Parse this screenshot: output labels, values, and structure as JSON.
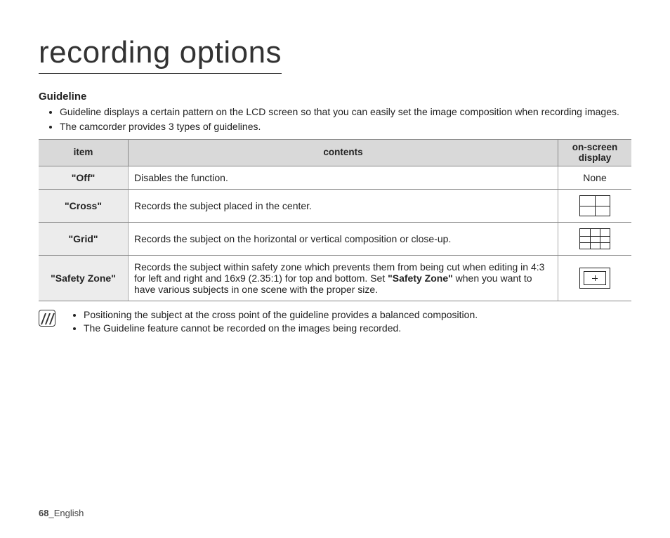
{
  "title": "recording options",
  "section": "Guideline",
  "intro": [
    "Guideline displays a certain pattern on the LCD screen so that you can easily set the image composition when recording images.",
    "The camcorder provides 3 types of guidelines."
  ],
  "table": {
    "headers": {
      "item": "item",
      "contents": "contents",
      "osd": "on-screen display"
    },
    "rows": [
      {
        "item": "\"Off\"",
        "contents": "Disables the function.",
        "osd_text": "None",
        "osd_icon": "none"
      },
      {
        "item": "\"Cross\"",
        "contents": "Records the subject placed in the center.",
        "osd_text": "",
        "osd_icon": "cross"
      },
      {
        "item": "\"Grid\"",
        "contents": "Records the subject on the horizontal or vertical composition or close-up.",
        "osd_text": "",
        "osd_icon": "grid"
      },
      {
        "item": "\"Safety Zone\"",
        "contents_prefix": "Records the subject within safety zone which prevents them from being cut when editing in 4:3 for left and right and 16x9 (2.35:1) for top and bottom. Set ",
        "contents_bold": "\"Safety Zone\"",
        "contents_suffix": " when you want to have various subjects in one scene with the proper size.",
        "osd_text": "",
        "osd_icon": "safety"
      }
    ]
  },
  "notes": [
    "Positioning the subject at the cross point of the guideline provides a balanced composition.",
    "The Guideline feature cannot be recorded on the images being recorded."
  ],
  "footer": {
    "page": "68",
    "lang": "_English"
  }
}
